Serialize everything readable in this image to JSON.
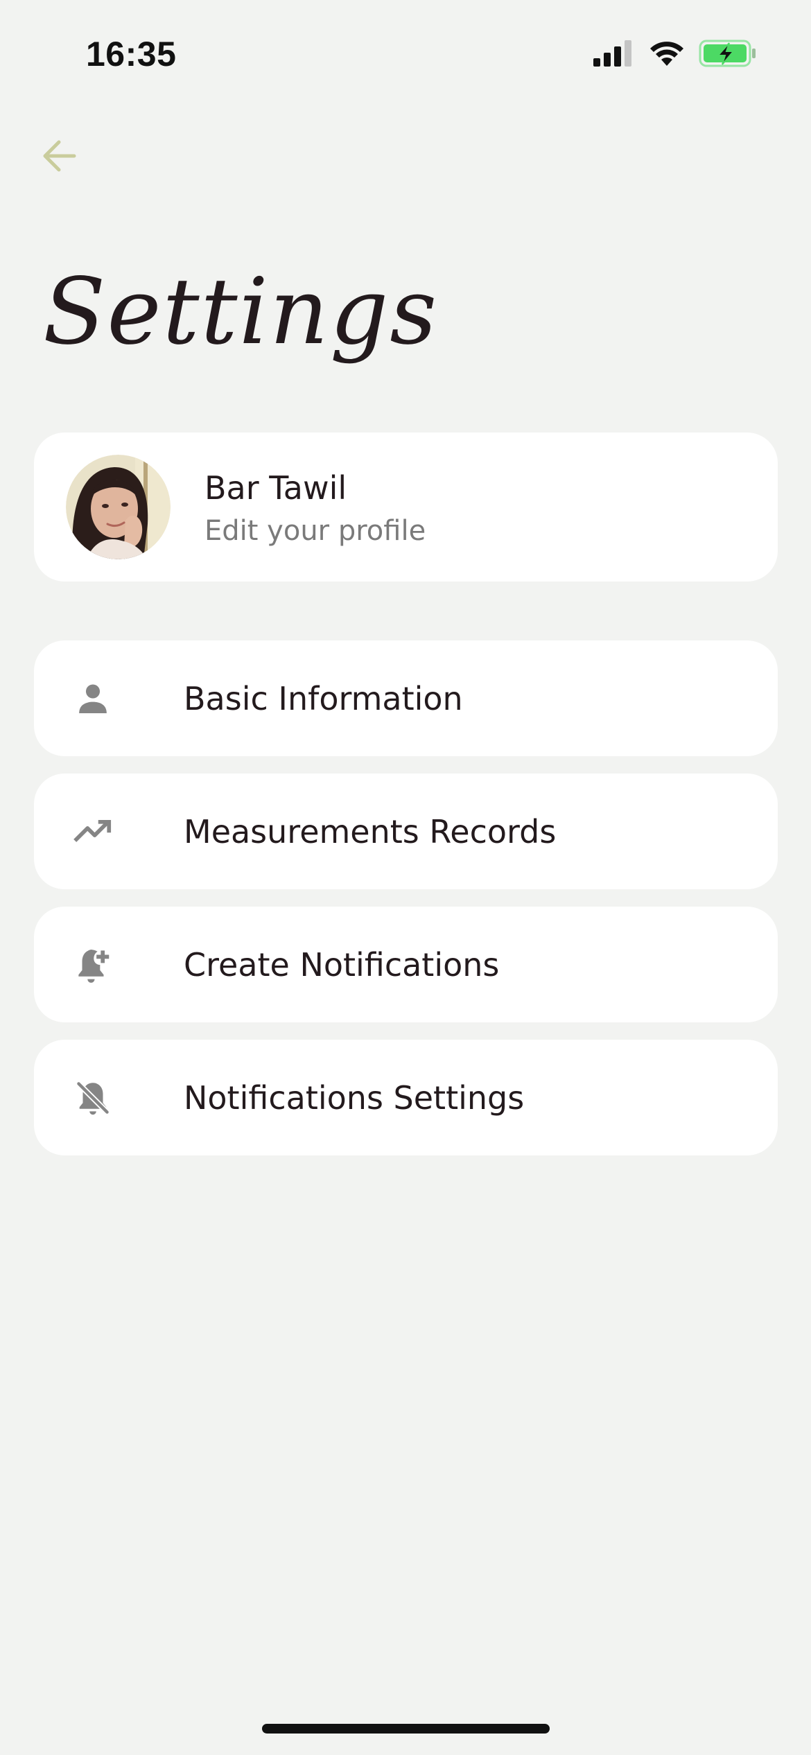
{
  "status_bar": {
    "time": "16:35",
    "signal_icon": "cellular-signal-icon",
    "wifi_icon": "wifi-icon",
    "battery_icon": "battery-charging-icon",
    "battery_color": "#4cd964"
  },
  "header": {
    "back_icon": "arrow-left-icon",
    "back_color": "#c9cc9c",
    "title": "Settings"
  },
  "profile": {
    "name": "Bar Tawil",
    "subtitle": "Edit your profile",
    "avatar": "user-avatar-photo"
  },
  "menu": {
    "items": [
      {
        "label": "Basic Information",
        "icon": "person-icon"
      },
      {
        "label": "Measurements Records",
        "icon": "trending-up-icon"
      },
      {
        "label": "Create Notifications",
        "icon": "bell-plus-icon"
      },
      {
        "label": "Notifications Settings",
        "icon": "bell-off-icon"
      }
    ]
  },
  "colors": {
    "background": "#f2f3f1",
    "card": "#ffffff",
    "text": "#231a1d",
    "muted_text": "#7a7a7a",
    "icon_gray": "#858585"
  }
}
